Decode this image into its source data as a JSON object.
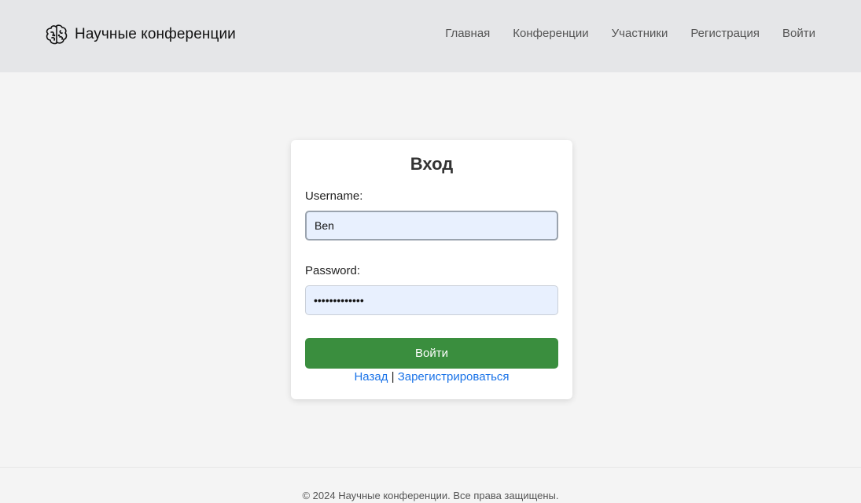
{
  "header": {
    "brand_title": "Научные конференции",
    "brand_icon": "brain-icon",
    "nav": {
      "home": "Главная",
      "conferences": "Конференции",
      "participants": "Участники",
      "registration": "Регистрация",
      "login": "Войти"
    }
  },
  "login_form": {
    "title": "Вход",
    "username_label": "Username:",
    "username_value": "Ben",
    "password_label": "Password:",
    "password_value": "•••••••••••••",
    "submit_label": "Войти",
    "back_link": "Назад",
    "separator": "|",
    "register_link": "Зарегистрироваться"
  },
  "footer": {
    "text": "© 2024 Научные конференции. Все права защищены."
  },
  "colors": {
    "header_bg": "#e5e6e8",
    "page_bg": "#f4f4f4",
    "submit_bg": "#3a8e3e",
    "link": "#1a73e8",
    "input_bg": "#e8f0fe"
  }
}
